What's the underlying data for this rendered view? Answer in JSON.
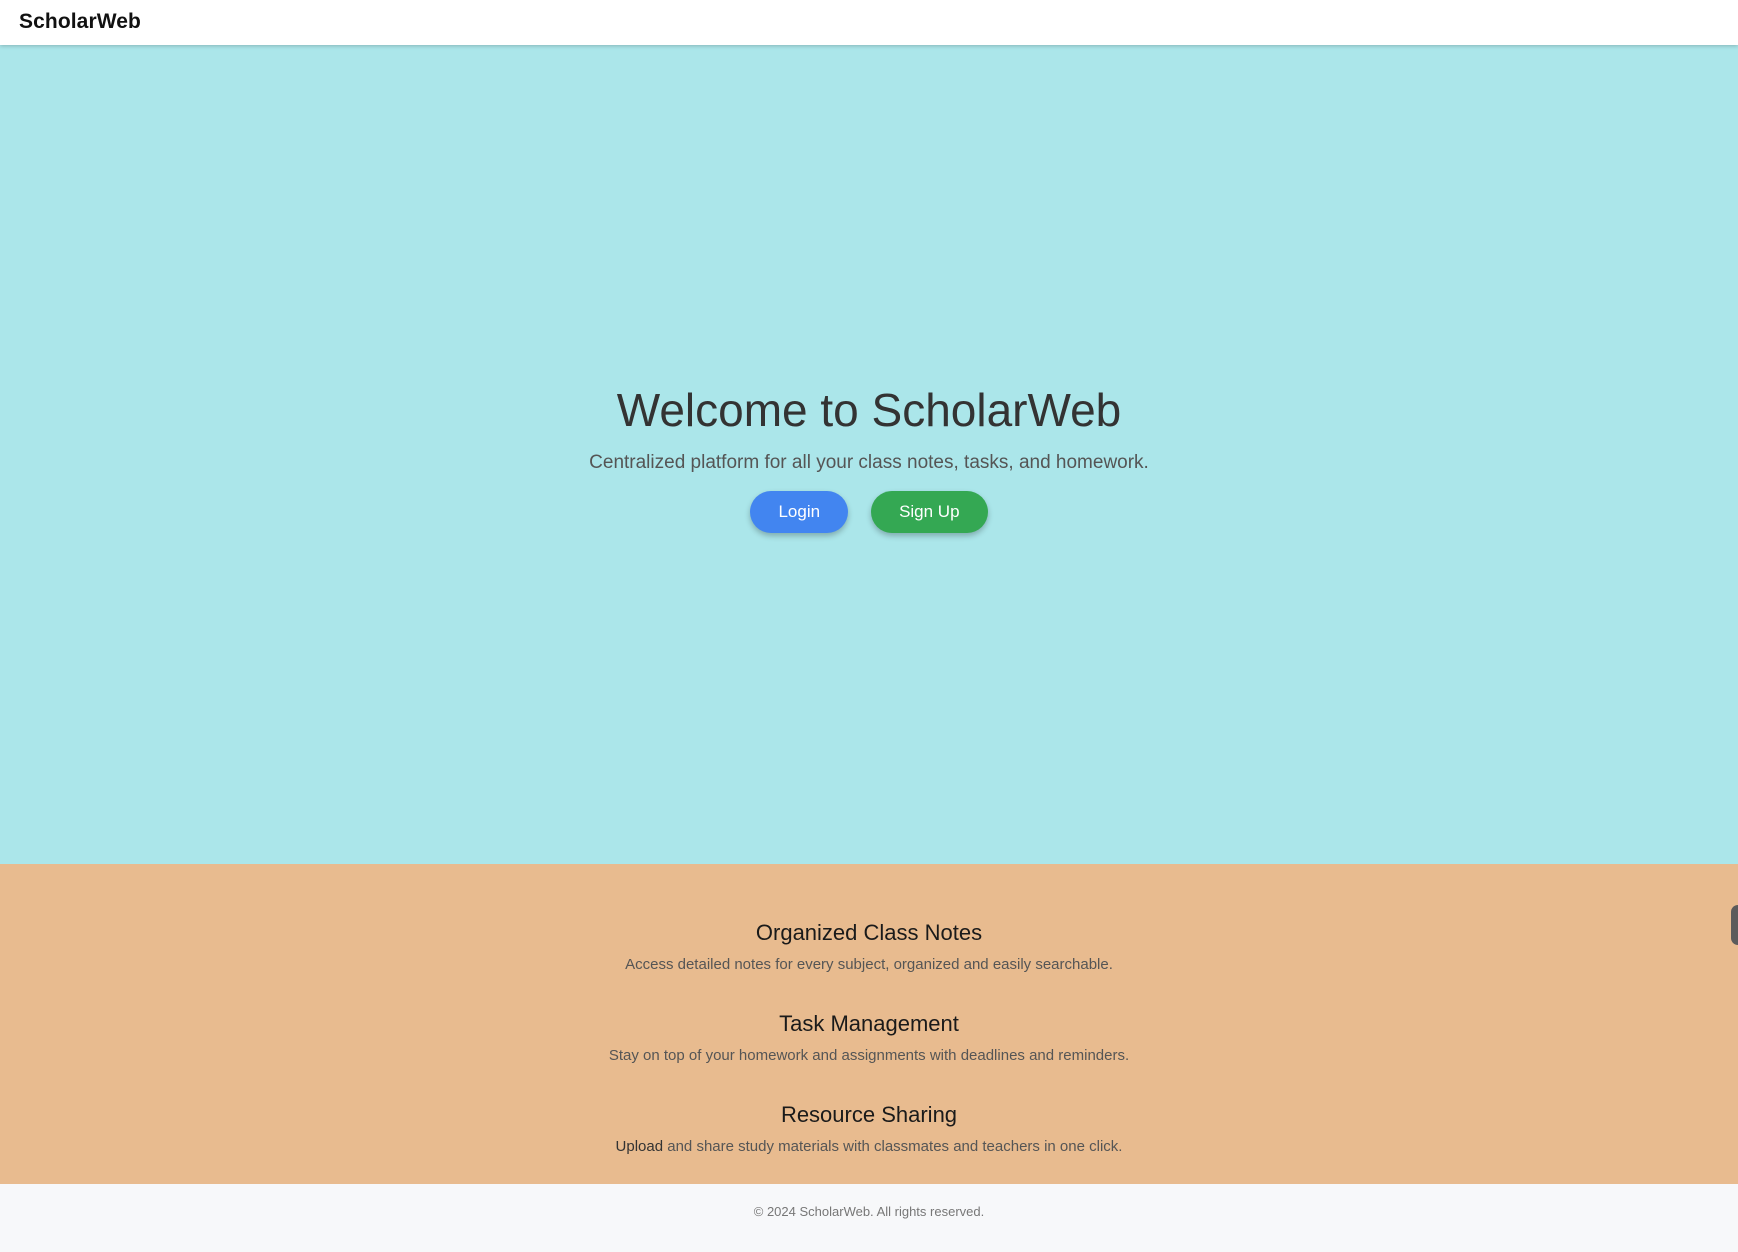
{
  "navbar": {
    "brand": "ScholarWeb"
  },
  "hero": {
    "title": "Welcome to ScholarWeb",
    "subtitle": "Centralized platform for all your class notes, tasks, and homework.",
    "login_label": "Login",
    "signup_label": "Sign Up"
  },
  "features": [
    {
      "title": "Organized Class Notes",
      "description": "Access detailed notes for every subject, organized and easily searchable."
    },
    {
      "title": "Task Management",
      "description": "Stay on top of your homework and assignments with deadlines and reminders."
    },
    {
      "title": "Resource Sharing",
      "description_lead": "Upload",
      "description_rest": " and share study materials with classmates and teachers in one click."
    }
  ],
  "footer": {
    "copyright": "© 2024 ScholarWeb. All rights reserved."
  },
  "colors": {
    "hero_bg": "#abe6ea",
    "features_bg": "#e8bb8f",
    "login_button": "#4285f0",
    "signup_button": "#34a853",
    "footer_bg": "#f7f8fa"
  }
}
